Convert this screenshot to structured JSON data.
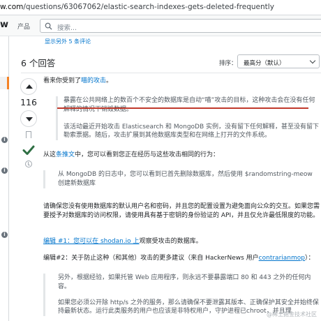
{
  "browser": {
    "url_host": "w.com",
    "url_path": "/questions/63067062/elastic-search-indexes-gets-deleted-frequently"
  },
  "topbar": {
    "logo_fragment": "w",
    "products": "产品",
    "search_placeholder": "搜索..."
  },
  "show_more_comments": "显示另外 5 条评论",
  "answers": {
    "count": "6 个回答",
    "sort_label": "排序：",
    "sort_value": "最高分（默认）"
  },
  "answer": {
    "score": "116",
    "intro_prefix": "看来你受到了",
    "intro_link": "喵的攻击",
    "intro_suffix": "。",
    "quote1_a": "暴露在公共网络上的数百个不安全的数据库是自动“喵”攻击的目标，这种攻击会在没有任何解释的情况下销毁数据。",
    "quote1_b": "该活动最近开始攻击 Elasticsearch 和 MongoDB 实例，没有留下任何解释，甚至没有留下勒索票据。随后，攻击扩展到其他数据库类型和在网络上打开的文件系统。",
    "tweet_prefix": "从这",
    "tweet_link": "条推文",
    "tweet_suffix": "中，您可以看到您正在经历与这些攻击相同的行为：",
    "quote2": "从 MongoDB 的日志中，您可以看到已首先删除数据库，然后使用 $randomstring-meow 创建新数据库",
    "advice": "请确保您没有使用数据库的默认用户名和密码，并且您的配置设置为避免面向公众的交互。如果您需要授予对数据库的访问权限，请使用具有基于密钥的身份验证的 API，并且仅允许最低限度的功能。",
    "edit1_link": "编辑 #1：您可以在 shodan.io 上",
    "edit1_suffix": "观察受攻击的数据库。",
    "edit2_prefix": "编辑#2：关于防止这种（和其他）攻击的更多建议（来自 HackerNews 用户",
    "edit2_user": "contrarianmop",
    "edit2_suffix": "）：",
    "quote3_a": "另外，根据经验，如果托管 Web 应用程序，则永远不要暴露端口 80 和 443 之外的任何内容。",
    "quote3_b": "如果您必须公开除 http/s 之外的服务，那么请确保不要泄露其版本、正确保护其安全并始终保持最新状态。运行此类服务的用户也应该是非特权用户，守护进程已chroot，并且理"
  },
  "watermark": "@稀土掘金技术社区",
  "colors": {
    "accent": "#f48225",
    "link": "#0074cc",
    "accepted": "#2f6f44",
    "underline": "#c0392b"
  }
}
